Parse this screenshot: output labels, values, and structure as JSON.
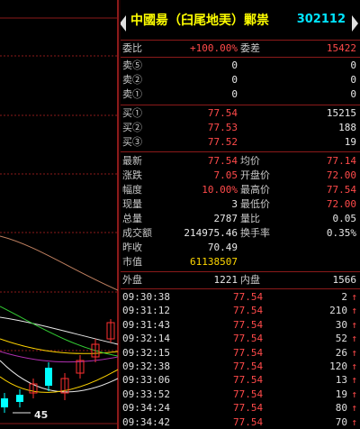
{
  "header": {
    "title": "中國昜（臼尾地㺯）鄛祟",
    "code": "302112"
  },
  "ratio": {
    "wb_label": "委比",
    "wb_value": "+100.00%",
    "wc_label": "委差",
    "wc_value": "15422"
  },
  "asks": [
    {
      "label": "卖⑤",
      "price": "0",
      "vol": "0"
    },
    {
      "label": "卖②",
      "price": "0",
      "vol": "0"
    },
    {
      "label": "卖①",
      "price": "0",
      "vol": "0"
    }
  ],
  "bids": [
    {
      "label": "买①",
      "price": "77.54",
      "vol": "15215"
    },
    {
      "label": "买②",
      "price": "77.53",
      "vol": "188"
    },
    {
      "label": "买③",
      "price": "77.52",
      "vol": "19"
    }
  ],
  "stats": [
    {
      "l1": "最新",
      "v1": "77.54",
      "c1": "red",
      "l2": "均价",
      "v2": "77.14",
      "c2": "red"
    },
    {
      "l1": "涨跌",
      "v1": "7.05",
      "c1": "red",
      "l2": "开盘价",
      "v2": "72.00",
      "c2": "red"
    },
    {
      "l1": "幅度",
      "v1": "10.00%",
      "c1": "red",
      "l2": "最高价",
      "v2": "77.54",
      "c2": "red"
    },
    {
      "l1": "现量",
      "v1": "3",
      "c1": "wht",
      "l2": "最低价",
      "v2": "72.00",
      "c2": "red"
    },
    {
      "l1": "总量",
      "v1": "2787",
      "c1": "wht",
      "l2": "量比",
      "v2": "0.05",
      "c2": "wht"
    },
    {
      "l1": "成交额",
      "v1": "214975.46",
      "c1": "wht",
      "l2": "换手率",
      "v2": "0.35%",
      "c2": "wht"
    },
    {
      "l1": "昨收",
      "v1": "70.49",
      "c1": "wht",
      "l2": "",
      "v2": "",
      "c2": "wht"
    },
    {
      "l1": "市值",
      "v1": "61138507",
      "c1": "yel",
      "l2": "",
      "v2": "",
      "c2": "wht"
    }
  ],
  "disk": {
    "out_label": "外盘",
    "out_value": "1221",
    "in_label": "内盘",
    "in_value": "1566"
  },
  "trades": [
    {
      "time": "09:30:38",
      "price": "77.54",
      "vol": "2"
    },
    {
      "time": "09:31:12",
      "price": "77.54",
      "vol": "210"
    },
    {
      "time": "09:31:43",
      "price": "77.54",
      "vol": "30"
    },
    {
      "time": "09:32:14",
      "price": "77.54",
      "vol": "52"
    },
    {
      "time": "09:32:15",
      "price": "77.54",
      "vol": "26"
    },
    {
      "time": "09:32:38",
      "price": "77.54",
      "vol": "120"
    },
    {
      "time": "09:33:06",
      "price": "77.54",
      "vol": "13"
    },
    {
      "time": "09:33:52",
      "price": "77.54",
      "vol": "19"
    },
    {
      "time": "09:34:24",
      "price": "77.54",
      "vol": "80"
    },
    {
      "time": "09:34:42",
      "price": "77.54",
      "vol": "70"
    }
  ],
  "trade_arrow": "↑",
  "chart": {
    "price_label": "45",
    "colors": {
      "frame": "#8b1a1a",
      "ma1": "#e8e8e8",
      "ma2": "#ffd400",
      "ma3": "#b030b0",
      "ma4": "#33cc33",
      "ma5": "#c08060",
      "up": "#ff3030",
      "down": "#00ffff"
    }
  }
}
